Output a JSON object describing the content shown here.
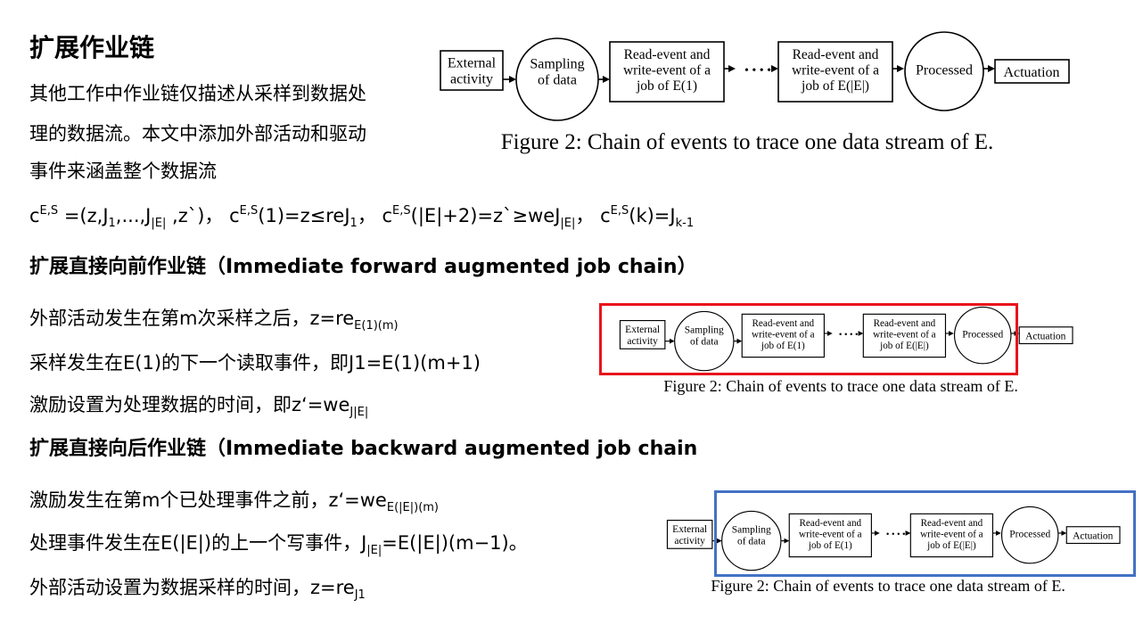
{
  "title": "扩展作业链",
  "intro": {
    "line1": "其他工作中作业链仅描述从采样到数据处",
    "line2": "理的数据流。本文中添加外部活动和驱动",
    "line3": "事件来涵盖整个数据流"
  },
  "formula": {
    "c": "c",
    "es": "E,S",
    "p1": " =(z,J",
    "s1": "1",
    "p2": ",...,J",
    "s2": "|E|",
    "p3": " ,z`)，",
    "p4": "(1)=z≤reJ",
    "s3": "1",
    "p5": "，",
    "p6": "(|E|+2)=z`≥weJ",
    "s4": "|E|",
    "p7": "，",
    "p8": "(k)=J",
    "s5": "k-1"
  },
  "forward": {
    "heading": "扩展直接向前作业链（Immediate forward augmented job chain）",
    "line1": "外部活动发生在第m次采样之后，z=re",
    "line1_sub": "E(1)(m)",
    "line2": "采样发生在E(1)的下一个读取事件，即J1=E(1)(m+1)",
    "line3": "激励设置为处理数据的时间，即z‘=we",
    "line3_sub": "J|E|"
  },
  "backward": {
    "heading": "扩展直接向后作业链（Immediate backward augmented job chain",
    "line1": "激励发生在第m个已处理事件之前，z‘=we",
    "line1_sub": "E(|E|)(m)",
    "line2": "处理事件发生在E(|E|)的上一个写事件，J",
    "line2_sub": "|E|",
    "line2_end": "=E(|E|)(m−1)。",
    "line3": "外部活动设置为数据采样的时间，z=re",
    "line3_sub": "J1"
  },
  "figure": {
    "external": [
      "External",
      "activity"
    ],
    "sampling": [
      "Sampling",
      "of data"
    ],
    "job1": [
      "Read-event and",
      "write-event of a",
      "job of E(1)"
    ],
    "jobE": [
      "Read-event and",
      "write-event of a",
      "job of E(|E|)"
    ],
    "dots": "• • • •",
    "processed": "Processed",
    "actuation": "Actuation",
    "caption": "Figure 2: Chain of events to trace one data stream of E."
  },
  "highlight_colors": {
    "forward": "#e8141b",
    "backward": "#4472c4"
  }
}
